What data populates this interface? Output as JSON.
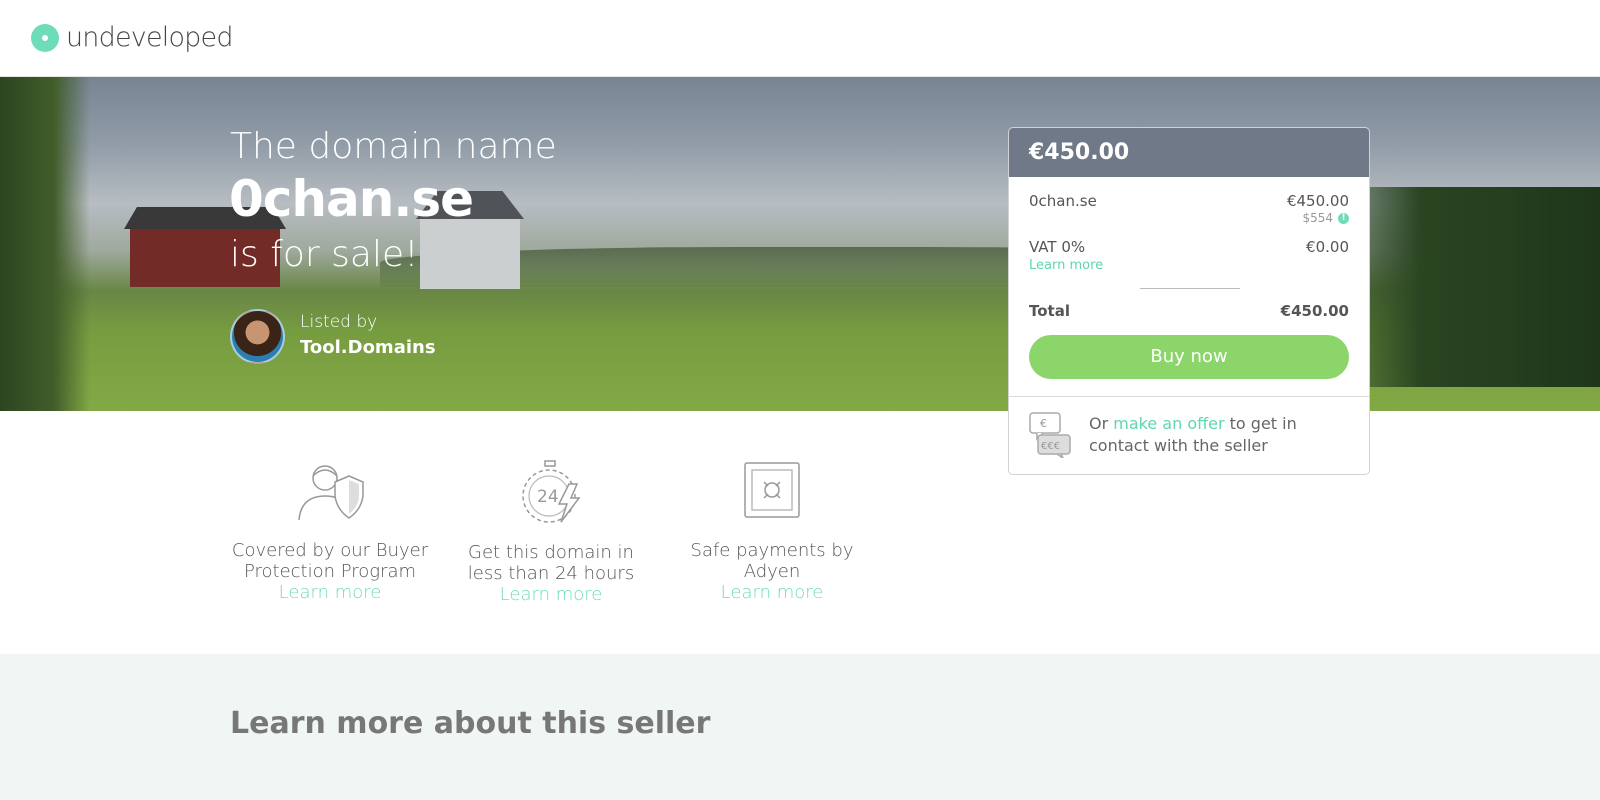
{
  "header": {
    "logo_text": "undeveloped"
  },
  "hero": {
    "line1": "The domain name",
    "domain": "0chan.se",
    "line3": "is for sale!",
    "listed_by_label": "Listed by",
    "seller_name": "Tool.Domains"
  },
  "card": {
    "header_price": "€450.00",
    "item_label": "0chan.se",
    "item_price": "€450.00",
    "item_price_usd": "$554",
    "vat_label": "VAT 0%",
    "vat_value": "€0.00",
    "vat_learn_more": "Learn more",
    "total_label": "Total",
    "total_value": "€450.00",
    "buy_button": "Buy now",
    "offer_prefix": "Or",
    "offer_link": "make an offer",
    "offer_suffix": "to get in contact with the seller"
  },
  "features": [
    {
      "text": "Covered by our Buyer Protection Program",
      "link": "Learn more",
      "icon": "buyer-protection-icon"
    },
    {
      "text": "Get this domain in less than 24 hours",
      "link": "Learn more",
      "icon": "stopwatch-24-icon"
    },
    {
      "text": "Safe payments by Adyen",
      "link": "Learn more",
      "icon": "safe-icon"
    }
  ],
  "seller_section": {
    "heading": "Learn more about this seller"
  },
  "colors": {
    "accent": "#6fdcb9",
    "buy_button": "#8bd56a",
    "card_header": "#707987",
    "seller_section_bg": "#eff6f4"
  }
}
